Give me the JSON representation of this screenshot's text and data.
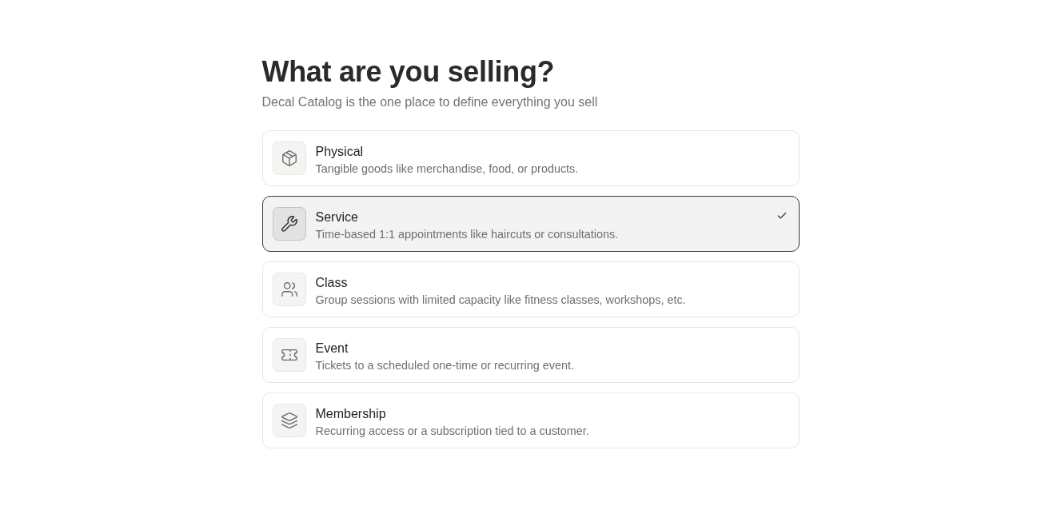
{
  "heading": {
    "title": "What are you selling?",
    "subtitle": "Decal Catalog is the one place to define everything you sell"
  },
  "options": [
    {
      "title": "Physical",
      "description": "Tangible goods like merchandise, food, or products.",
      "selected": false
    },
    {
      "title": "Service",
      "description": "Time-based 1:1 appointments like haircuts or consultations.",
      "selected": true
    },
    {
      "title": "Class",
      "description": "Group sessions with limited capacity like fitness classes, workshops, etc.",
      "selected": false
    },
    {
      "title": "Event",
      "description": "Tickets to a scheduled one-time or recurring event.",
      "selected": false
    },
    {
      "title": "Membership",
      "description": "Recurring access or a subscription tied to a customer.",
      "selected": false
    }
  ]
}
